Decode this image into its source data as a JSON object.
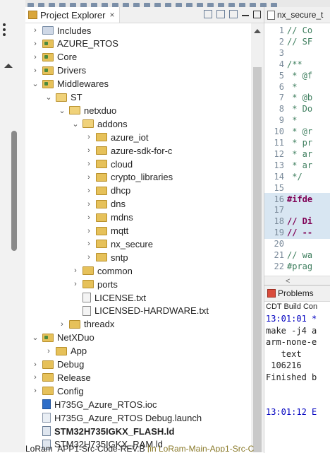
{
  "explorer": {
    "tab_title": "Project Explorer",
    "tab_close": "×",
    "tree": [
      {
        "label": "Includes",
        "icon": "includes",
        "indent": 0,
        "chev": "›",
        "bold": false
      },
      {
        "label": "AZURE_RTOS",
        "icon": "project-folder",
        "indent": 0,
        "chev": "›",
        "bold": false
      },
      {
        "label": "Core",
        "icon": "project-folder",
        "indent": 0,
        "chev": "›",
        "bold": false
      },
      {
        "label": "Drivers",
        "icon": "project-folder",
        "indent": 0,
        "chev": "›",
        "bold": false
      },
      {
        "label": "Middlewares",
        "icon": "project-folder",
        "indent": 0,
        "chev": "⌄",
        "bold": false
      },
      {
        "label": "ST",
        "icon": "folder",
        "indent": 1,
        "chev": "⌄",
        "bold": false
      },
      {
        "label": "netxduo",
        "icon": "folder",
        "indent": 2,
        "chev": "⌄",
        "bold": false
      },
      {
        "label": "addons",
        "icon": "folder",
        "indent": 3,
        "chev": "⌄",
        "bold": false
      },
      {
        "label": "azure_iot",
        "icon": "folder",
        "indent": 4,
        "chev": "›",
        "bold": false
      },
      {
        "label": "azure-sdk-for-c",
        "icon": "folder",
        "indent": 4,
        "chev": "›",
        "bold": false
      },
      {
        "label": "cloud",
        "icon": "folder",
        "indent": 4,
        "chev": "›",
        "bold": false
      },
      {
        "label": "crypto_libraries",
        "icon": "folder",
        "indent": 4,
        "chev": "›",
        "bold": false
      },
      {
        "label": "dhcp",
        "icon": "folder",
        "indent": 4,
        "chev": "›",
        "bold": false
      },
      {
        "label": "dns",
        "icon": "folder",
        "indent": 4,
        "chev": "›",
        "bold": false
      },
      {
        "label": "mdns",
        "icon": "folder",
        "indent": 4,
        "chev": "›",
        "bold": false
      },
      {
        "label": "mqtt",
        "icon": "folder",
        "indent": 4,
        "chev": "›",
        "bold": false
      },
      {
        "label": "nx_secure",
        "icon": "folder",
        "indent": 4,
        "chev": "›",
        "bold": false
      },
      {
        "label": "sntp",
        "icon": "folder",
        "indent": 4,
        "chev": "›",
        "bold": false
      },
      {
        "label": "common",
        "icon": "folder",
        "indent": 3,
        "chev": "›",
        "bold": false
      },
      {
        "label": "ports",
        "icon": "folder",
        "indent": 3,
        "chev": "›",
        "bold": false
      },
      {
        "label": "LICENSE.txt",
        "icon": "file",
        "indent": 3,
        "chev": "",
        "bold": false
      },
      {
        "label": "LICENSED-HARDWARE.txt",
        "icon": "file",
        "indent": 3,
        "chev": "",
        "bold": false
      },
      {
        "label": "threadx",
        "icon": "folder",
        "indent": 2,
        "chev": "›",
        "bold": false
      },
      {
        "label": "NetXDuo",
        "icon": "project-folder",
        "indent": 0,
        "chev": "⌄",
        "bold": false
      },
      {
        "label": "App",
        "icon": "folder",
        "indent": 1,
        "chev": "›",
        "bold": false
      },
      {
        "label": "Debug",
        "icon": "folder",
        "indent": 0,
        "chev": "›",
        "bold": false
      },
      {
        "label": "Release",
        "icon": "folder",
        "indent": 0,
        "chev": "›",
        "bold": false
      },
      {
        "label": "Config",
        "icon": "folder",
        "indent": 0,
        "chev": "›",
        "bold": false
      },
      {
        "label": "H735G_Azure_RTOS.ioc",
        "icon": "mx-file",
        "indent": 0,
        "chev": "",
        "bold": false
      },
      {
        "label": "H735G_Azure_RTOS Debug.launch",
        "icon": "launch-file",
        "indent": 0,
        "chev": "",
        "bold": false
      },
      {
        "label": "STM32H735IGKX_FLASH.ld",
        "icon": "ld-file",
        "indent": 0,
        "chev": "",
        "bold": true
      },
      {
        "label": "STM32H735IGKX_RAM.ld",
        "icon": "ld-file",
        "indent": 0,
        "chev": "",
        "bold": false
      }
    ],
    "bottom_row_a": "LoRam_APP1-Src-Code-REV.B",
    "bottom_row_b": " [in LoRam-Main-App1-Src-C"
  },
  "editor": {
    "tab_title": "nx_secure_t",
    "lines": [
      {
        "n": "1",
        "t": "// Co",
        "hl": false,
        "fold": true
      },
      {
        "n": "2",
        "t": "// SF",
        "hl": false,
        "fold": false
      },
      {
        "n": "3",
        "t": "",
        "hl": false,
        "fold": false
      },
      {
        "n": "4",
        "t": "/**",
        "hl": false,
        "fold": true
      },
      {
        "n": "5",
        "t": " * @f",
        "hl": false,
        "fold": false
      },
      {
        "n": "6",
        "t": " *",
        "hl": false,
        "fold": false
      },
      {
        "n": "7",
        "t": " * @b",
        "hl": false,
        "fold": false
      },
      {
        "n": "8",
        "t": " * Do",
        "hl": false,
        "fold": false
      },
      {
        "n": "9",
        "t": " *",
        "hl": false,
        "fold": false
      },
      {
        "n": "10",
        "t": " * @r",
        "hl": false,
        "fold": false
      },
      {
        "n": "11",
        "t": " * pr",
        "hl": false,
        "fold": false
      },
      {
        "n": "12",
        "t": " * ar",
        "hl": false,
        "fold": false
      },
      {
        "n": "13",
        "t": " * ar",
        "hl": false,
        "fold": false
      },
      {
        "n": "14",
        "t": " */",
        "hl": false,
        "fold": false
      },
      {
        "n": "15",
        "t": "",
        "hl": false,
        "fold": false
      },
      {
        "n": "16",
        "t": "#ifde",
        "hl": true,
        "fold": false
      },
      {
        "n": "17",
        "t": "",
        "hl": true,
        "fold": false
      },
      {
        "n": "18",
        "t": "// Di",
        "hl": true,
        "fold": true
      },
      {
        "n": "19",
        "t": "// --",
        "hl": true,
        "fold": false
      },
      {
        "n": "20",
        "t": "",
        "hl": false,
        "fold": false
      },
      {
        "n": "21",
        "t": "// wa",
        "hl": false,
        "fold": false
      },
      {
        "n": "22",
        "t": "#prag",
        "hl": false,
        "fold": false
      }
    ],
    "hscroll_left": "<"
  },
  "console": {
    "tab_title": "Problems",
    "title": "CDT Build Con",
    "lines": [
      {
        "t": "13:01:01 *",
        "blue": true
      },
      {
        "t": "make -j4 a",
        "blue": false
      },
      {
        "t": "arm-none-e",
        "blue": false
      },
      {
        "t": "   text",
        "blue": false
      },
      {
        "t": " 106216",
        "blue": false
      },
      {
        "t": "Finished b",
        "blue": false
      },
      {
        "t": "",
        "blue": false
      },
      {
        "t": "",
        "blue": false
      },
      {
        "t": "13:01:12 E",
        "blue": true
      }
    ]
  }
}
